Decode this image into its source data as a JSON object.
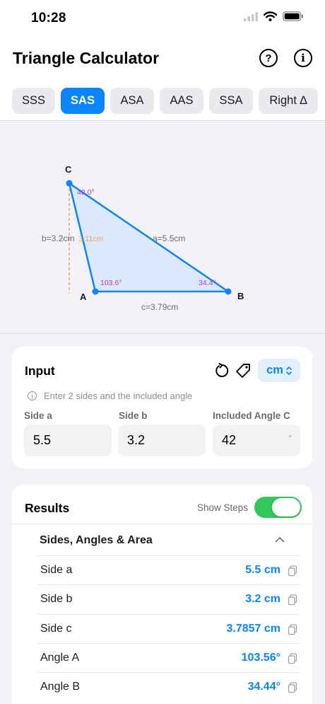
{
  "status": {
    "time": "10:28"
  },
  "header": {
    "title": "Triangle Calculator",
    "help_icon": "?",
    "info_icon": "i"
  },
  "tabs": [
    {
      "label": "SSS",
      "active": false
    },
    {
      "label": "SAS",
      "active": true
    },
    {
      "label": "ASA",
      "active": false
    },
    {
      "label": "AAS",
      "active": false
    },
    {
      "label": "SSA",
      "active": false
    },
    {
      "label": "Right ∆",
      "active": false
    }
  ],
  "diagram": {
    "vertices": {
      "a": "A",
      "b": "B",
      "c": "C"
    },
    "side_labels": {
      "a": "a=5.5cm",
      "b": "b=3.2cm",
      "c": "c=3.79cm",
      "height": "3.11cm"
    },
    "angle_labels": {
      "a": "103.6°",
      "b": "34.4°",
      "c": "42.0°"
    },
    "colors": {
      "fill": "#DCE8FB",
      "stroke": "#0A84FF",
      "angle_text": "#B437D8",
      "height_line": "#F2A65A",
      "label_text": "#6b6b70"
    }
  },
  "input": {
    "title": "Input",
    "unit": "cm",
    "hint": "Enter 2 sides and the included angle",
    "fields": [
      {
        "label": "Side a",
        "value": "5.5"
      },
      {
        "label": "Side b",
        "value": "3.2"
      },
      {
        "label": "Included Angle C",
        "value": "42",
        "suffix": "°"
      }
    ]
  },
  "results": {
    "title": "Results",
    "show_steps_label": "Show Steps",
    "show_steps_on": true,
    "section_title": "Sides, Angles & Area",
    "rows": [
      {
        "label": "Side a",
        "value": "5.5 cm"
      },
      {
        "label": "Side b",
        "value": "3.2 cm"
      },
      {
        "label": "Side c",
        "value": "3.7857 cm"
      },
      {
        "label": "Angle A",
        "value": "103.56°"
      },
      {
        "label": "Angle B",
        "value": "34.44°"
      }
    ]
  },
  "colors": {
    "accent": "#0A84FF",
    "toggle_on": "#34C759",
    "background": "#F2F2F7"
  }
}
